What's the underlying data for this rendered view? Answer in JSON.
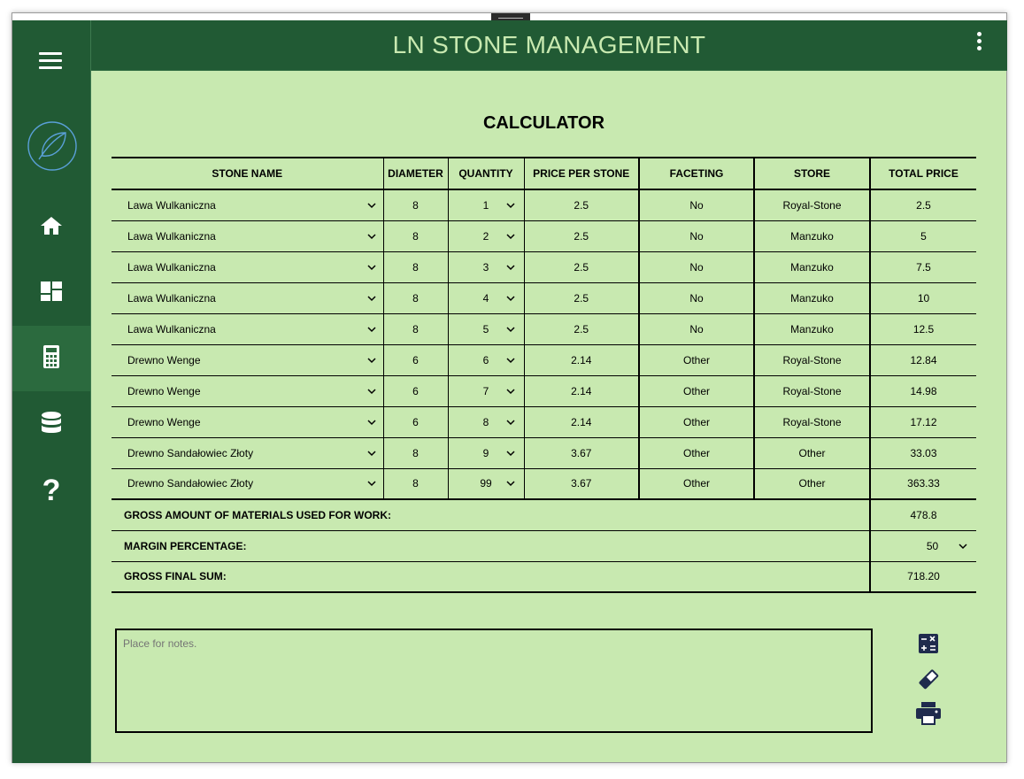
{
  "app": {
    "title": "LN STONE MANAGEMENT"
  },
  "sidebar": {
    "items": [
      {
        "name": "home-icon"
      },
      {
        "name": "dashboard-icon"
      },
      {
        "name": "calculator-icon",
        "active": true
      },
      {
        "name": "database-icon"
      },
      {
        "name": "help-icon",
        "glyph": "?"
      }
    ]
  },
  "calculator": {
    "title": "CALCULATOR",
    "columns": [
      "STONE NAME",
      "DIAMETER",
      "QUANTITY",
      "PRICE PER STONE",
      "FACETING",
      "STORE",
      "TOTAL PRICE"
    ],
    "rows": [
      {
        "stone": "Lawa Wulkaniczna",
        "diameter": "8",
        "quantity": "1",
        "price": "2.5",
        "faceting": "No",
        "store": "Royal-Stone",
        "total": "2.5"
      },
      {
        "stone": "Lawa Wulkaniczna",
        "diameter": "8",
        "quantity": "2",
        "price": "2.5",
        "faceting": "No",
        "store": "Manzuko",
        "total": "5"
      },
      {
        "stone": "Lawa Wulkaniczna",
        "diameter": "8",
        "quantity": "3",
        "price": "2.5",
        "faceting": "No",
        "store": "Manzuko",
        "total": "7.5"
      },
      {
        "stone": "Lawa Wulkaniczna",
        "diameter": "8",
        "quantity": "4",
        "price": "2.5",
        "faceting": "No",
        "store": "Manzuko",
        "total": "10"
      },
      {
        "stone": "Lawa Wulkaniczna",
        "diameter": "8",
        "quantity": "5",
        "price": "2.5",
        "faceting": "No",
        "store": "Manzuko",
        "total": "12.5"
      },
      {
        "stone": "Drewno Wenge",
        "diameter": "6",
        "quantity": "6",
        "price": "2.14",
        "faceting": "Other",
        "store": "Royal-Stone",
        "total": "12.84"
      },
      {
        "stone": "Drewno Wenge",
        "diameter": "6",
        "quantity": "7",
        "price": "2.14",
        "faceting": "Other",
        "store": "Royal-Stone",
        "total": "14.98"
      },
      {
        "stone": "Drewno Wenge",
        "diameter": "6",
        "quantity": "8",
        "price": "2.14",
        "faceting": "Other",
        "store": "Royal-Stone",
        "total": "17.12"
      },
      {
        "stone": "Drewno Sandałowiec Złoty",
        "diameter": "8",
        "quantity": "9",
        "price": "3.67",
        "faceting": "Other",
        "store": "Other",
        "total": "33.03"
      },
      {
        "stone": "Drewno Sandałowiec Złoty",
        "diameter": "8",
        "quantity": "99",
        "price": "3.67",
        "faceting": "Other",
        "store": "Other",
        "total": "363.33"
      }
    ],
    "summary": {
      "gross_label": "GROSS AMOUNT OF MATERIALS USED FOR WORK:",
      "gross_value": "478.8",
      "margin_label": "MARGIN PERCENTAGE:",
      "margin_value": "50",
      "final_label": "GROSS FINAL SUM:",
      "final_value": "718.20"
    },
    "notes_placeholder": "Place for notes.",
    "actions": [
      "calculate-icon",
      "eraser-icon",
      "print-icon"
    ]
  },
  "colors": {
    "sidebar": "#215a34",
    "background": "#c8e9b0",
    "title_text": "#c8e9b0",
    "action_icons": "#1f2b4d"
  }
}
